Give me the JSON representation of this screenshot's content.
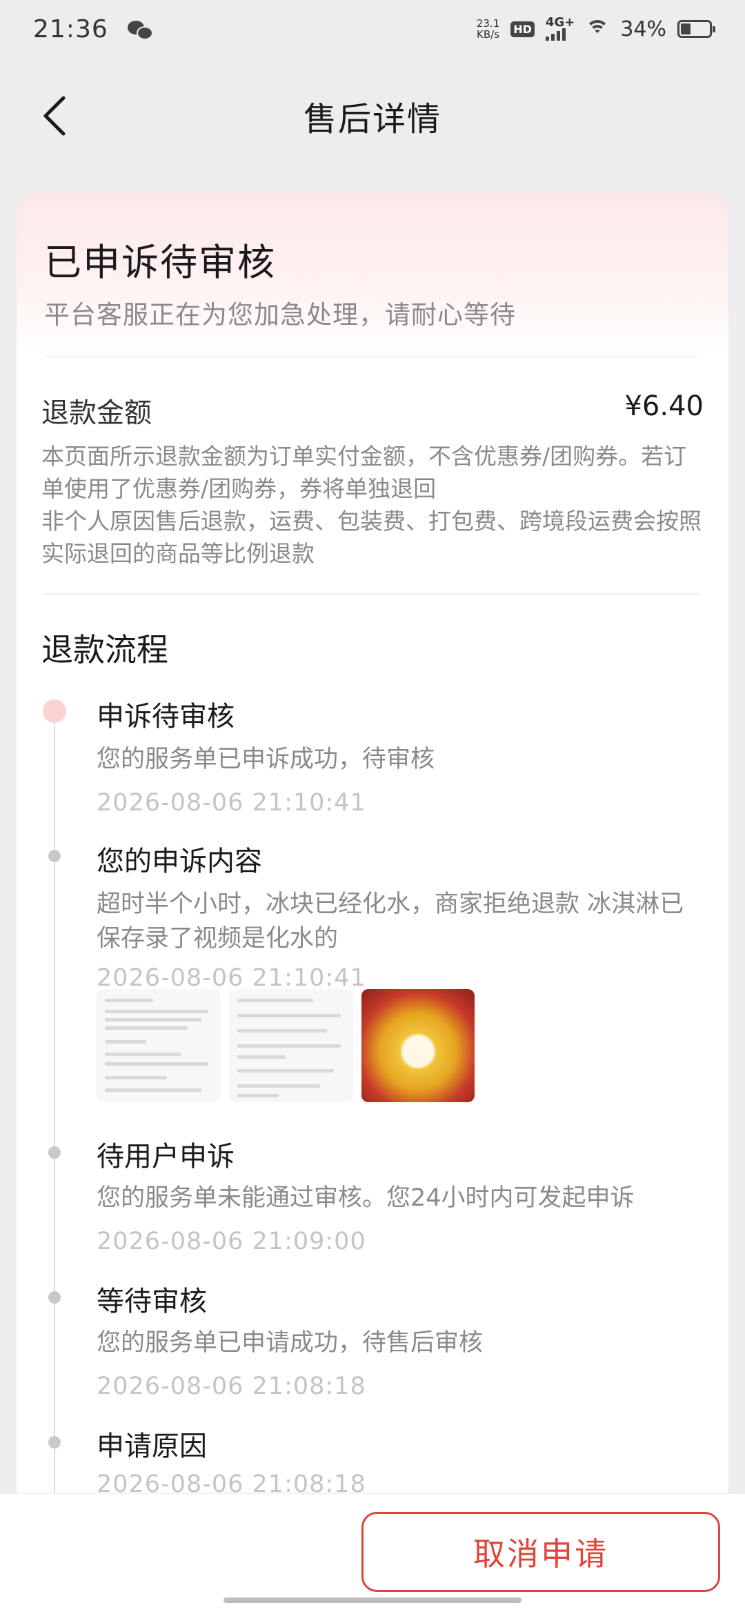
{
  "status_bar": {
    "time": "21:36",
    "net_speed_value": "23.1",
    "net_speed_unit": "KB/s",
    "hd": "HD",
    "network": "4G+",
    "battery": "34%",
    "battery_level": 0.34
  },
  "header": {
    "title": "售后详情"
  },
  "status": {
    "title": "已申诉待审核",
    "subtitle": "平台客服正在为您加急处理，请耐心等待"
  },
  "refund": {
    "label": "退款金额",
    "amount": "¥6.40",
    "note_1": "本页面所示退款金额为订单实付金额，不含优惠券/团购券。若订单使用了优惠券/团购券，券将单独退回",
    "note_2": "非个人原因售后退款，运费、包装费、打包费、跨境段运费会按照实际退回的商品等比例退款"
  },
  "flow": {
    "title": "退款流程",
    "steps": [
      {
        "title": "申诉待审核",
        "desc": "您的服务单已申诉成功，待审核",
        "time": "2026-08-06 21:10:41"
      },
      {
        "title": "您的申诉内容",
        "desc": "超时半个小时，冰块已经化水，商家拒绝退款 冰淇淋已保存录了视频是化水的",
        "time": "2026-08-06 21:10:41"
      },
      {
        "title": "待用户申诉",
        "desc": "您的服务单未能通过审核。您24小时内可发起申诉",
        "time": "2026-08-06 21:09:00"
      },
      {
        "title": "等待审核",
        "desc": "您的服务单已申请成功，待售后审核",
        "time": "2026-08-06 21:08:18"
      },
      {
        "title": "申请原因",
        "time": "2026-08-06 21:08:18"
      }
    ]
  },
  "bottom": {
    "cancel_label": "取消申请"
  },
  "colors": {
    "accent": "#e0443a",
    "active_dot": "#fbd3d3"
  }
}
